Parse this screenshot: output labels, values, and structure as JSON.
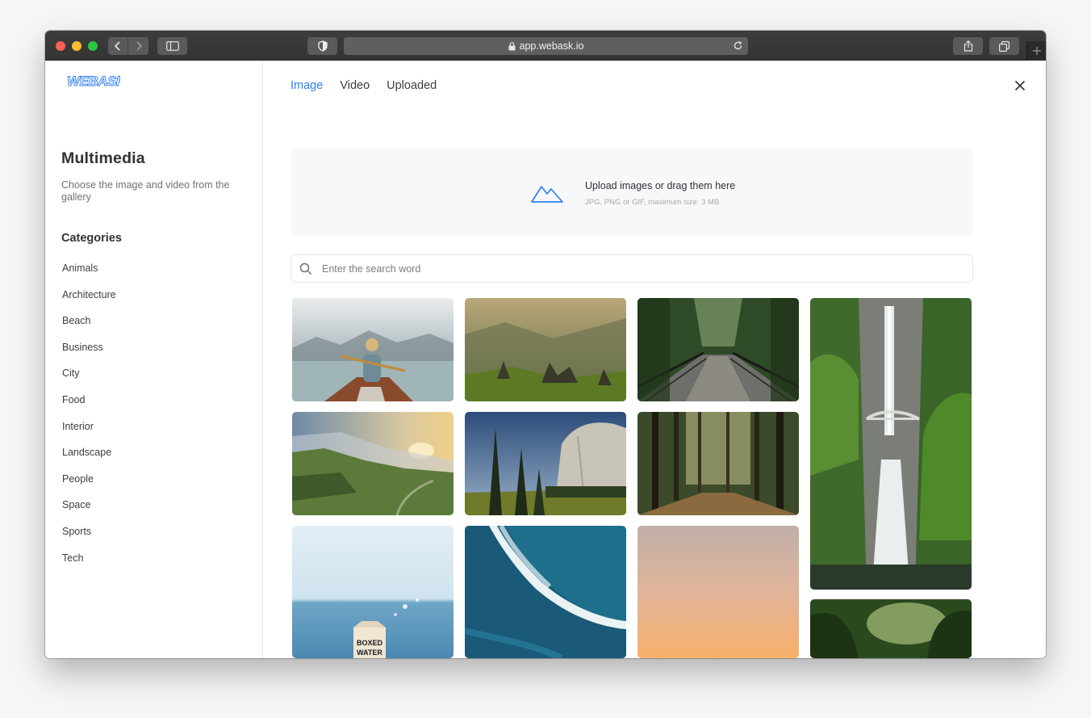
{
  "browser": {
    "url": "app.webask.io"
  },
  "sidebar": {
    "logo_text": "WEBASK",
    "title": "Multimedia",
    "description": "Choose the image and video from the gallery",
    "categories_title": "Categories",
    "categories": [
      "Animals",
      "Architecture",
      "Beach",
      "Business",
      "City",
      "Food",
      "Interior",
      "Landscape",
      "People",
      "Space",
      "Sports",
      "Tech"
    ]
  },
  "tabs": [
    {
      "label": "Image",
      "active": true
    },
    {
      "label": "Video",
      "active": false
    },
    {
      "label": "Uploaded",
      "active": false
    }
  ],
  "upload": {
    "title": "Upload images or drag them here",
    "subtitle": "JPG, PNG or GIF, maximum size: 3 MB"
  },
  "search": {
    "placeholder": "Enter the search word",
    "value": ""
  },
  "gallery": {
    "carton_text_line1": "BOXED",
    "carton_text_line2": "WATER"
  },
  "colors": {
    "accent": "#2f80ed",
    "text_primary": "#2e3338",
    "text_muted": "#6d7278"
  }
}
